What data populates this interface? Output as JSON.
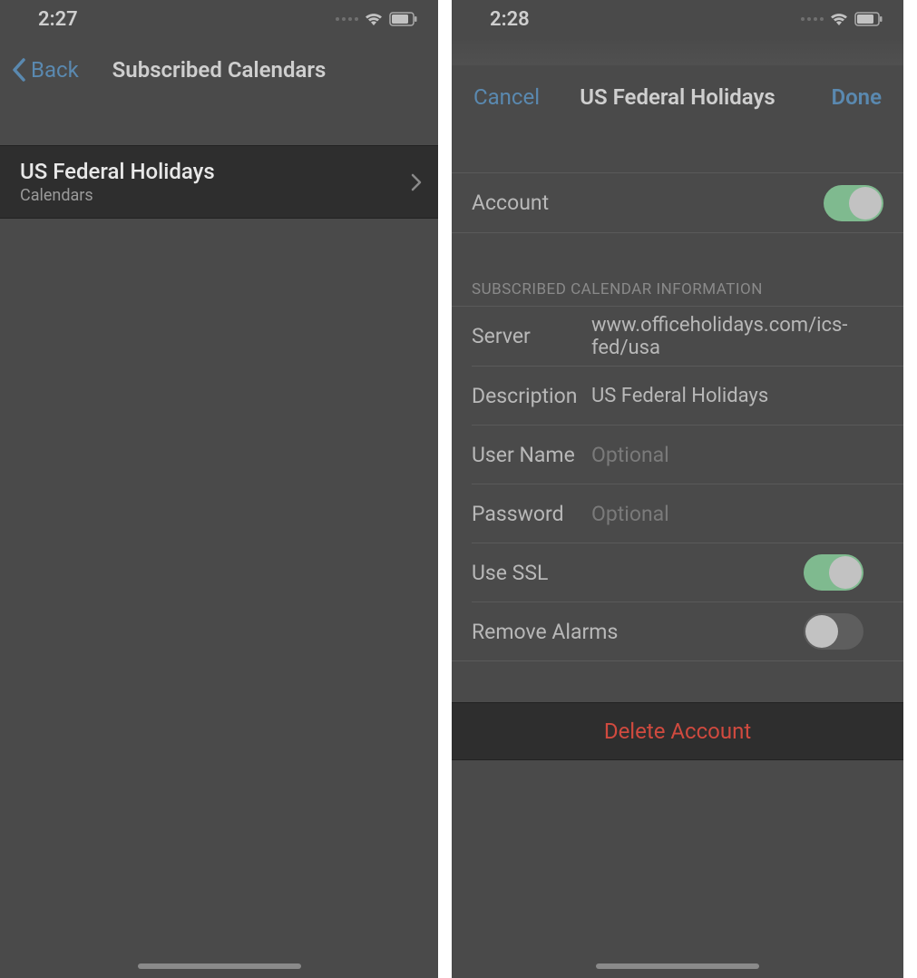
{
  "left": {
    "status": {
      "time": "2:27"
    },
    "nav": {
      "back_label": "Back",
      "title": "Subscribed Calendars"
    },
    "item": {
      "title": "US Federal Holidays",
      "subtitle": "Calendars"
    }
  },
  "right": {
    "status": {
      "time": "2:28"
    },
    "nav": {
      "cancel_label": "Cancel",
      "title": "US Federal Holidays",
      "done_label": "Done"
    },
    "account": {
      "label": "Account",
      "enabled": true
    },
    "section_header": "SUBSCRIBED CALENDAR INFORMATION",
    "fields": {
      "server_label": "Server",
      "server_value": "www.officeholidays.com/ics-fed/usa",
      "description_label": "Description",
      "description_value": "US Federal Holidays",
      "username_label": "User Name",
      "username_placeholder": "Optional",
      "password_label": "Password",
      "password_placeholder": "Optional",
      "usessl_label": "Use SSL",
      "usessl_on": true,
      "removealarms_label": "Remove Alarms",
      "removealarms_on": false
    },
    "delete_label": "Delete Account"
  }
}
